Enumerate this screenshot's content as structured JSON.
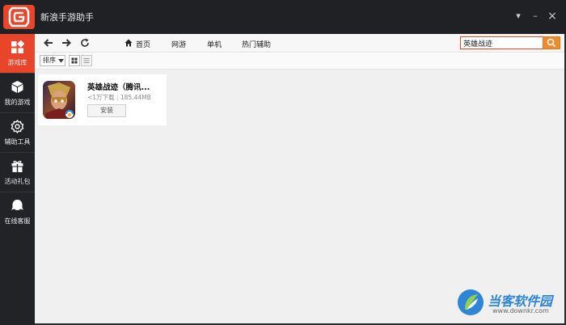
{
  "app": {
    "title": "新浪手游助手"
  },
  "window_controls": {
    "menu_glyph": "▾",
    "minimize_glyph": "–",
    "close_glyph": "×"
  },
  "sidebar": {
    "items": [
      {
        "label": "游戏库",
        "icon": "game-library-icon",
        "active": true
      },
      {
        "label": "我的游戏",
        "icon": "box-icon",
        "active": false
      },
      {
        "label": "辅助工具",
        "icon": "gear-icon",
        "active": false
      },
      {
        "label": "活动礼包",
        "icon": "gift-icon",
        "active": false
      },
      {
        "label": "在线客服",
        "icon": "chat-bubble-icon",
        "active": false
      }
    ]
  },
  "nav": {
    "links": [
      "首页",
      "网游",
      "单机",
      "热门辅助"
    ],
    "search_value": "英雄战迹"
  },
  "toolbar": {
    "sort_label": "排序"
  },
  "results": [
    {
      "title": "英雄战迹（腾讯...",
      "downloads": "<1万下载",
      "size": "185.44MB",
      "install_label": "安装"
    }
  ],
  "watermark": {
    "name": "当客软件园",
    "url": "www.downkr.com"
  },
  "colors": {
    "accent": "#e8452b",
    "search_button": "#ef8a2d",
    "sidebar_bg": "#222327"
  }
}
